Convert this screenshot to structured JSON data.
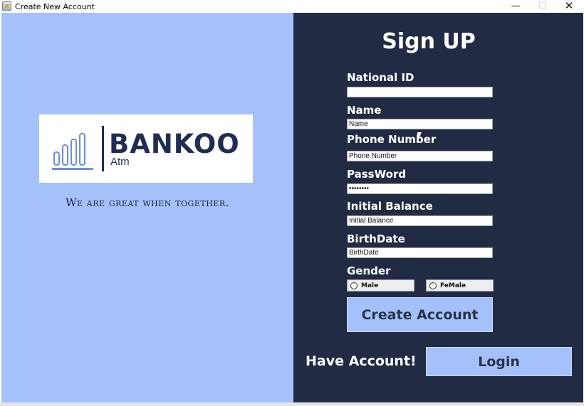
{
  "window": {
    "title": "Create New Account",
    "minimize": "—",
    "maximize": "☐",
    "close": "✕"
  },
  "brand": {
    "name": "BANKOO",
    "subtitle": "Atm",
    "slogan": "We are great when together."
  },
  "form": {
    "heading": "Sign UP",
    "national_id": {
      "label": "National ID",
      "value": ""
    },
    "name": {
      "label": "Name",
      "value": "Name"
    },
    "phone": {
      "label": "Phone Number",
      "value": "Phone Number"
    },
    "password": {
      "label": "PassWord",
      "value": "••••••••"
    },
    "initial_balance": {
      "label": "Initial Balance",
      "value": "Initial Balance"
    },
    "birthdate": {
      "label": "BirthDate",
      "value": "BirthDate"
    },
    "gender": {
      "label": "Gender",
      "options": [
        "Male",
        "FeMale"
      ]
    },
    "create_button": "Create Account"
  },
  "footer": {
    "have_account": "Have Account!",
    "login_button": "Login"
  },
  "colors": {
    "left_panel": "#a4c1fb",
    "right_panel": "#212b44",
    "brand_dark": "#1f2d54",
    "brand_accent": "#6c8fd6"
  },
  "icons": {
    "app": "java-app-icon",
    "logo": "bar-chart-icon",
    "cursor": "mouse-pointer-icon"
  }
}
